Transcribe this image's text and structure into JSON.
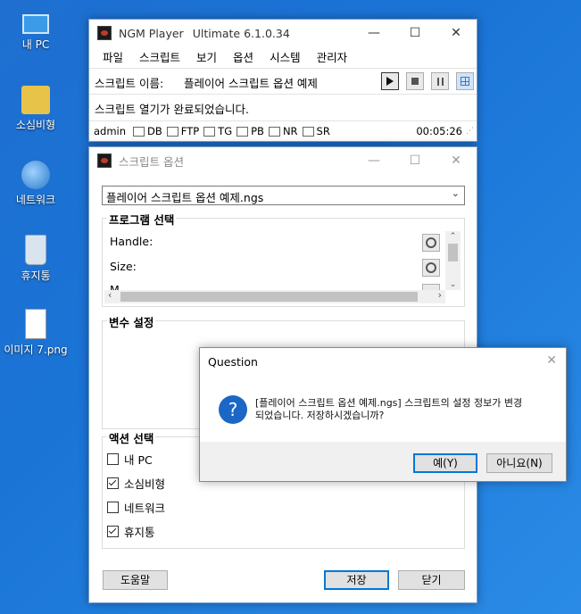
{
  "desktop": {
    "icons": [
      {
        "label": "내 PC"
      },
      {
        "label": "소심비형"
      },
      {
        "label": "네트워크"
      },
      {
        "label": "휴지통"
      },
      {
        "label": "이미지 7.png"
      }
    ]
  },
  "player": {
    "title": "NGM Player",
    "version": "Ultimate 6.1.0.34",
    "menu": [
      "파일",
      "스크립트",
      "보기",
      "옵션",
      "시스템",
      "관리자"
    ],
    "script_name_label": "스크립트 이름:",
    "script_name_value": "플레이어 스크립트 옵션 예제",
    "status_message": "스크립트 열기가 완료되었습니다.",
    "status_user": "admin",
    "status_flags": [
      "DB",
      "FTP",
      "TG",
      "PB",
      "NR",
      "SR"
    ],
    "elapsed_time": "00:05:26"
  },
  "options": {
    "title": "스크립트 옵션",
    "script_select_value": "플레이어 스크립트 옵션 예제.ngs",
    "program_group_title": "프로그램 선택",
    "program_rows": [
      "Handle:",
      "Size:",
      "M"
    ],
    "variable_group_title": "변수 설정",
    "action_group_title": "액션 선택",
    "actions": [
      {
        "label": "내 PC",
        "checked": false
      },
      {
        "label": "소심비형",
        "checked": true
      },
      {
        "label": "네트워크",
        "checked": false
      },
      {
        "label": "휴지통",
        "checked": true
      }
    ],
    "help_button": "도움말",
    "save_button": "저장",
    "close_button": "닫기"
  },
  "dialog": {
    "title": "Question",
    "message_line1": "[플레이어 스크립트 옵션 예제.ngs] 스크립트의 설정 정보가 변경",
    "message_line2": "되었습니다. 저장하시겠습니까?",
    "yes_button": "예(Y)",
    "no_button": "아니요(N)",
    "question_glyph": "?"
  }
}
